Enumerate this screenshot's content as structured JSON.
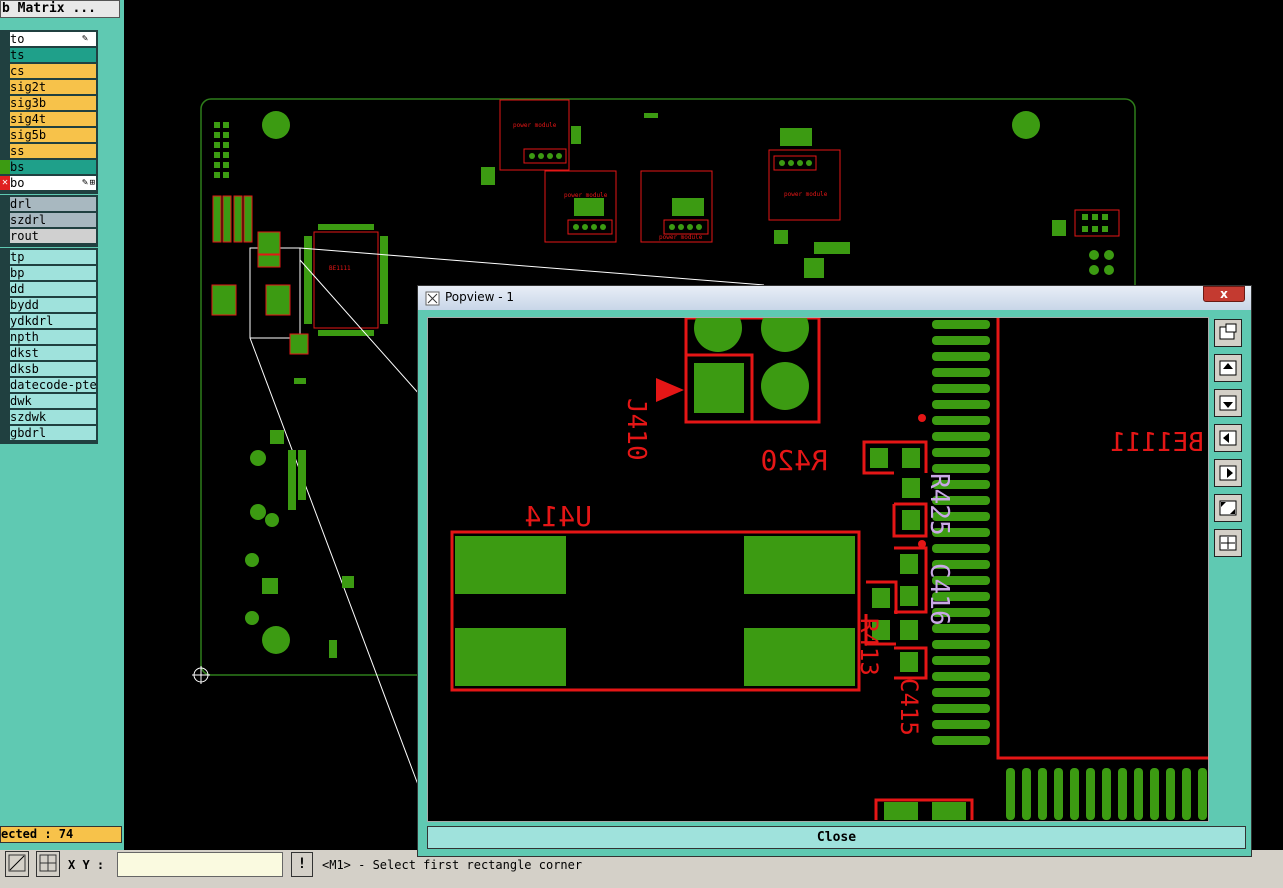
{
  "matrix_title": "b Matrix ...",
  "layer_group_1": [
    {
      "name": "to",
      "swatch": "#ffffff",
      "bg": "#ffffff",
      "marks": [
        "✎"
      ]
    },
    {
      "name": "ts",
      "swatch": "#1fa08a",
      "bg": "#1fa08a",
      "marks": []
    },
    {
      "name": "cs",
      "swatch": "#f7c24a",
      "bg": "#f7c24a",
      "marks": []
    },
    {
      "name": "sig2t",
      "swatch": "#f7c24a",
      "bg": "#f7c24a",
      "marks": []
    },
    {
      "name": "sig3b",
      "swatch": "#f7c24a",
      "bg": "#f7c24a",
      "marks": []
    },
    {
      "name": "sig4t",
      "swatch": "#f7c24a",
      "bg": "#f7c24a",
      "marks": []
    },
    {
      "name": "sig5b",
      "swatch": "#f7c24a",
      "bg": "#f7c24a",
      "marks": []
    },
    {
      "name": "ss",
      "swatch": "#f7c24a",
      "bg": "#f7c24a",
      "marks": []
    },
    {
      "name": "bs",
      "swatch": "#1fa08a",
      "bg": "#1fa08a",
      "marks": []
    },
    {
      "name": "bo",
      "swatch": "#ffffff",
      "bg": "#ffffff",
      "marks": [
        "✎",
        "⊞"
      ]
    }
  ],
  "layer_group_2": [
    {
      "name": "drl",
      "bg": "#a8b8c0"
    },
    {
      "name": "szdrl",
      "bg": "#a8b8c0"
    },
    {
      "name": "rout",
      "bg": "#d0d0d0"
    }
  ],
  "layer_group_3": [
    {
      "name": "tp"
    },
    {
      "name": "bp"
    },
    {
      "name": "dd"
    },
    {
      "name": "bydd"
    },
    {
      "name": "ydkdrl"
    },
    {
      "name": "npth"
    },
    {
      "name": "dkst"
    },
    {
      "name": "dksb"
    },
    {
      "name": "datecode-pte"
    },
    {
      "name": "dwk"
    },
    {
      "name": "szdwk"
    },
    {
      "name": "gbdrl"
    }
  ],
  "selected_text": "ected : 74",
  "status": {
    "xy_label": "X Y :",
    "xy_value": "",
    "excl_label": "!",
    "prompt": "<M1> - Select first rectangle corner"
  },
  "popview": {
    "title": "Popview - 1",
    "close_x": "x",
    "close_button": "Close",
    "labels": {
      "j410": "J410",
      "r420": "R420",
      "u414": "U414",
      "be1111": "BE1111",
      "r425": "R425",
      "c416": "C416",
      "r413": "R413",
      "c415": "C415"
    }
  },
  "board_labels": {
    "power_module_1": "power module",
    "power_module_2": "power module",
    "power_module_3": "power module",
    "power_module_4": "power module",
    "be1111_small": "BE1111"
  },
  "colors": {
    "copper": "#3c9b12",
    "silk": "#e51616",
    "outline": "#2e7d1a",
    "panel": "#5fc9b2",
    "mint_silk": "#c9a9e6"
  }
}
